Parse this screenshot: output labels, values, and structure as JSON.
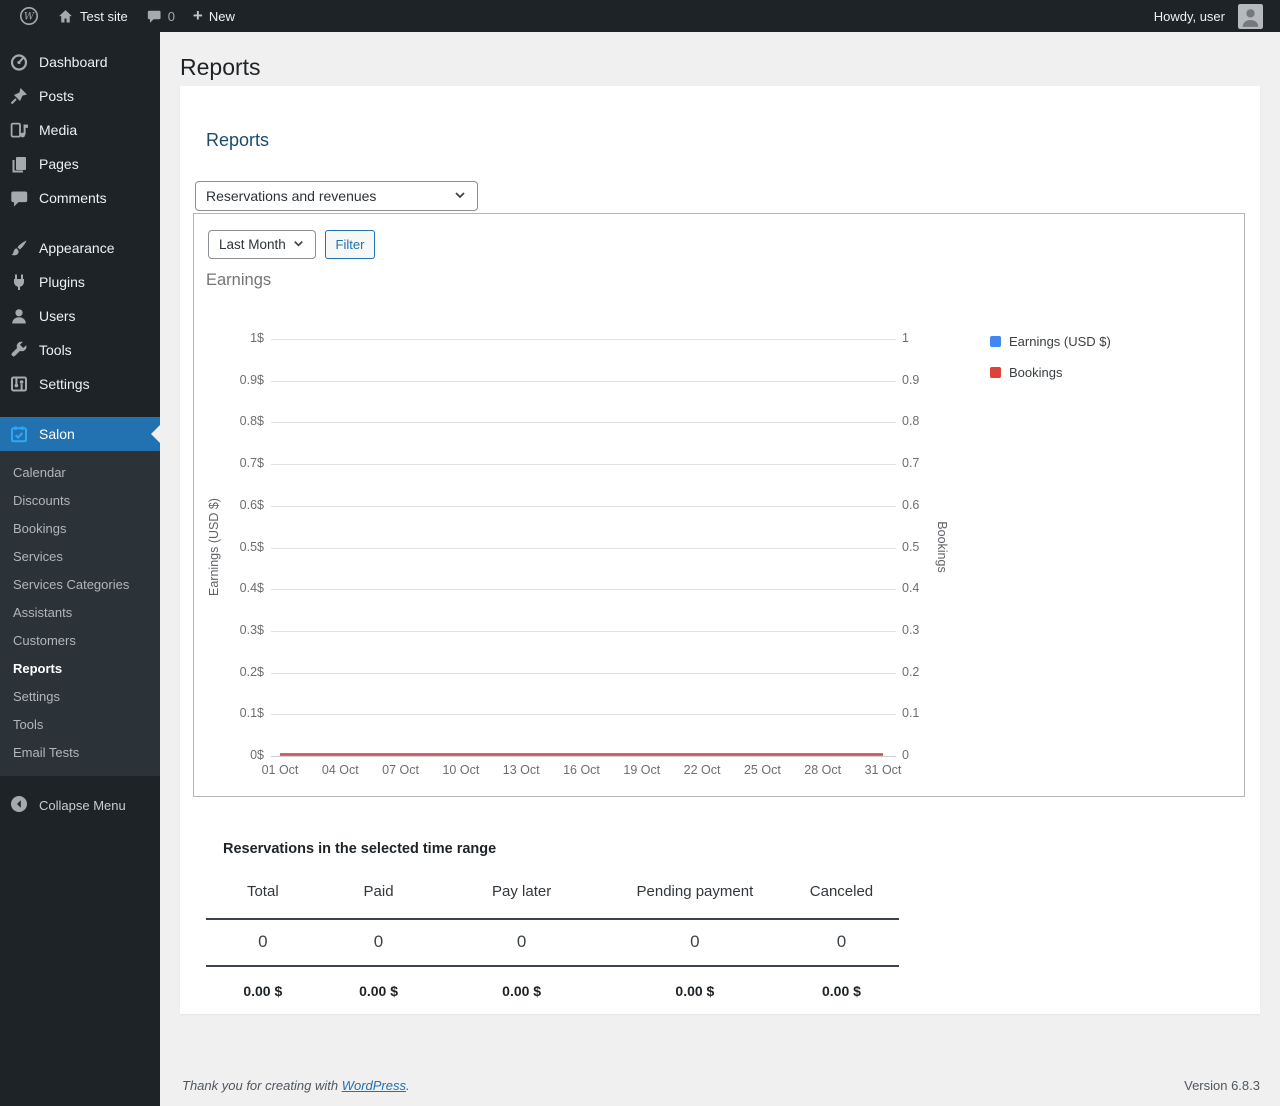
{
  "admin_bar": {
    "site_name": "Test site",
    "comments_count": "0",
    "new_label": "New",
    "howdy": "Howdy, user",
    "icons": [
      "wordpress-logo",
      "home-icon",
      "comment-icon",
      "plus-icon",
      "avatar"
    ]
  },
  "sidebar": {
    "items": [
      {
        "label": "Dashboard",
        "icon": "dashboard-icon"
      },
      {
        "label": "Posts",
        "icon": "pin-icon"
      },
      {
        "label": "Media",
        "icon": "media-icon"
      },
      {
        "label": "Pages",
        "icon": "pages-icon"
      },
      {
        "label": "Comments",
        "icon": "comment-icon",
        "separator_after": true
      },
      {
        "label": "Appearance",
        "icon": "brush-icon"
      },
      {
        "label": "Plugins",
        "icon": "plugin-icon"
      },
      {
        "label": "Users",
        "icon": "user-icon"
      },
      {
        "label": "Tools",
        "icon": "wrench-icon"
      },
      {
        "label": "Settings",
        "icon": "settings-icon",
        "separator_after": true
      },
      {
        "label": "Salon",
        "icon": "calendar-check-icon",
        "active": true
      }
    ],
    "salon_submenu": [
      {
        "label": "Calendar"
      },
      {
        "label": "Discounts"
      },
      {
        "label": "Bookings"
      },
      {
        "label": "Services"
      },
      {
        "label": "Services Categories"
      },
      {
        "label": "Assistants"
      },
      {
        "label": "Customers"
      },
      {
        "label": "Reports",
        "current": true
      },
      {
        "label": "Settings"
      },
      {
        "label": "Tools"
      },
      {
        "label": "Email Tests"
      }
    ],
    "collapse_label": "Collapse Menu"
  },
  "page": {
    "title": "Reports"
  },
  "card": {
    "heading": "Reports",
    "report_type_select": "Reservations and revenues",
    "period_select": "Last Month",
    "filter_button": "Filter",
    "chart_label": "Earnings"
  },
  "chart_data": {
    "type": "line",
    "title": "Earnings",
    "x_tick_labels": [
      "01 Oct",
      "04 Oct",
      "07 Oct",
      "10 Oct",
      "13 Oct",
      "16 Oct",
      "19 Oct",
      "22 Oct",
      "25 Oct",
      "28 Oct",
      "31 Oct"
    ],
    "x_days": 31,
    "series": [
      {
        "name": "Earnings (USD $)",
        "color": "#4285f4",
        "axis": "left",
        "values": [
          0,
          0,
          0,
          0,
          0,
          0,
          0,
          0,
          0,
          0,
          0,
          0,
          0,
          0,
          0,
          0,
          0,
          0,
          0,
          0,
          0,
          0,
          0,
          0,
          0,
          0,
          0,
          0,
          0,
          0,
          0
        ]
      },
      {
        "name": "Bookings",
        "color": "#db4437",
        "axis": "right",
        "values": [
          0,
          0,
          0,
          0,
          0,
          0,
          0,
          0,
          0,
          0,
          0,
          0,
          0,
          0,
          0,
          0,
          0,
          0,
          0,
          0,
          0,
          0,
          0,
          0,
          0,
          0,
          0,
          0,
          0,
          0,
          0
        ]
      }
    ],
    "left_axis": {
      "title": "Earnings (USD $)",
      "range": [
        0,
        1
      ],
      "ticks": [
        "0$",
        "0.1$",
        "0.2$",
        "0.3$",
        "0.4$",
        "0.5$",
        "0.6$",
        "0.7$",
        "0.8$",
        "0.9$",
        "1$"
      ]
    },
    "right_axis": {
      "title": "Bookings",
      "range": [
        0,
        1
      ],
      "ticks": [
        "0",
        "0.1",
        "0.2",
        "0.3",
        "0.4",
        "0.5",
        "0.6",
        "0.7",
        "0.8",
        "0.9",
        "1"
      ]
    },
    "legend_position": "right",
    "grid": true
  },
  "summary": {
    "title": "Reservations in the selected time range",
    "columns": [
      "Total",
      "Paid",
      "Pay later",
      "Pending payment",
      "Canceled"
    ],
    "counts": [
      "0",
      "0",
      "0",
      "0",
      "0"
    ],
    "amounts": [
      "0.00 $",
      "0.00 $",
      "0.00 $",
      "0.00 $",
      "0.00 $"
    ]
  },
  "footer": {
    "thanks_prefix": "Thank you for creating with ",
    "wordpress_link": "WordPress",
    "thanks_suffix": ".",
    "version": "Version 6.8.3"
  },
  "colors": {
    "admin_dark": "#1d2327",
    "submenu_bg": "#2c3338",
    "active_blue": "#2271b1",
    "salon_icon_blue": "#2ea8f5",
    "chart_blue": "#4285f4",
    "chart_red": "#db4437",
    "body_bg": "#f0f0f1"
  }
}
